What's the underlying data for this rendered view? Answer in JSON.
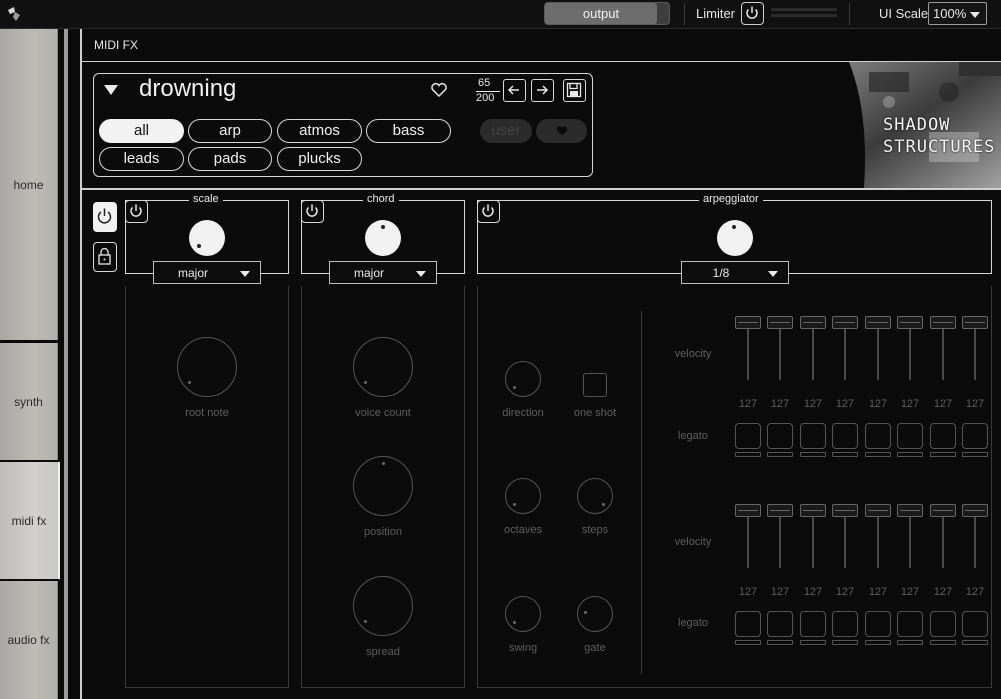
{
  "topbar": {
    "output_label": "output",
    "limiter_label": "Limiter",
    "ui_scale_label": "UI Scale",
    "ui_scale_value": "100%"
  },
  "sidebar": {
    "items": [
      {
        "label": "home"
      },
      {
        "label": "synth"
      },
      {
        "label": "midi fx",
        "active": true
      },
      {
        "label": "audio fx"
      }
    ]
  },
  "header": {
    "title": "MIDI FX"
  },
  "preset": {
    "name": "drowning",
    "index": "65",
    "total": "200",
    "tags": [
      "all",
      "arp",
      "atmos",
      "bass",
      "leads",
      "pads",
      "plucks"
    ],
    "active_tag": "all",
    "filters": [
      "user"
    ],
    "art_text": [
      "SHADOW",
      "STRUCTURES"
    ]
  },
  "scale": {
    "title": "scale",
    "mode": "major",
    "knob_label": "root note"
  },
  "chord": {
    "title": "chord",
    "mode": "major",
    "knob_labels": [
      "voice count",
      "position",
      "spread"
    ]
  },
  "arpeggiator": {
    "title": "arpeggiator",
    "rate": "1/8",
    "knob_labels": {
      "direction": "direction",
      "one_shot": "one shot",
      "octaves": "octaves",
      "steps": "steps",
      "swing": "swing",
      "gate": "gate"
    },
    "velocity_label": "velocity",
    "legato_label": "legato",
    "rows": [
      {
        "velocities": [
          "127",
          "127",
          "127",
          "127",
          "127",
          "127",
          "127",
          "127"
        ]
      },
      {
        "velocities": [
          "127",
          "127",
          "127",
          "127",
          "127",
          "127",
          "127",
          "127"
        ]
      }
    ]
  },
  "colors": {
    "background": "#0b0b0c",
    "border": "#d8d8d8",
    "dim": "#5e5e5e",
    "sidebar": "#bdbbb6"
  }
}
